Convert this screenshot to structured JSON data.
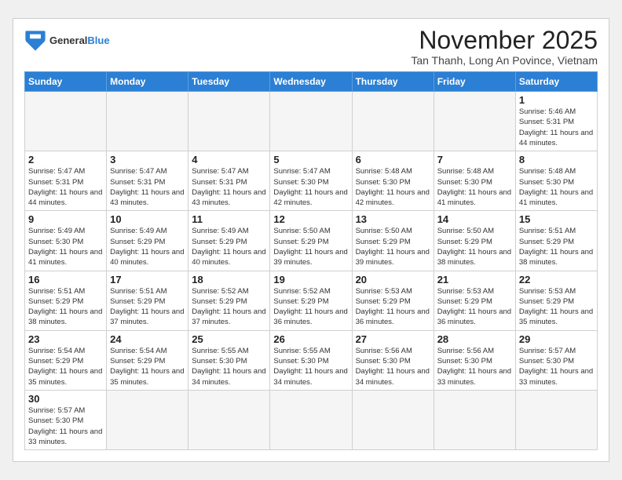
{
  "header": {
    "logo_general": "General",
    "logo_blue": "Blue",
    "month_title": "November 2025",
    "location": "Tan Thanh, Long An Povince, Vietnam"
  },
  "days_of_week": [
    "Sunday",
    "Monday",
    "Tuesday",
    "Wednesday",
    "Thursday",
    "Friday",
    "Saturday"
  ],
  "weeks": [
    [
      {
        "day": "",
        "empty": true
      },
      {
        "day": "",
        "empty": true
      },
      {
        "day": "",
        "empty": true
      },
      {
        "day": "",
        "empty": true
      },
      {
        "day": "",
        "empty": true
      },
      {
        "day": "",
        "empty": true
      },
      {
        "day": "1",
        "sunrise": "5:46 AM",
        "sunset": "5:31 PM",
        "daylight": "11 hours and 44 minutes."
      }
    ],
    [
      {
        "day": "2",
        "sunrise": "5:47 AM",
        "sunset": "5:31 PM",
        "daylight": "11 hours and 44 minutes."
      },
      {
        "day": "3",
        "sunrise": "5:47 AM",
        "sunset": "5:31 PM",
        "daylight": "11 hours and 43 minutes."
      },
      {
        "day": "4",
        "sunrise": "5:47 AM",
        "sunset": "5:31 PM",
        "daylight": "11 hours and 43 minutes."
      },
      {
        "day": "5",
        "sunrise": "5:47 AM",
        "sunset": "5:30 PM",
        "daylight": "11 hours and 42 minutes."
      },
      {
        "day": "6",
        "sunrise": "5:48 AM",
        "sunset": "5:30 PM",
        "daylight": "11 hours and 42 minutes."
      },
      {
        "day": "7",
        "sunrise": "5:48 AM",
        "sunset": "5:30 PM",
        "daylight": "11 hours and 41 minutes."
      },
      {
        "day": "8",
        "sunrise": "5:48 AM",
        "sunset": "5:30 PM",
        "daylight": "11 hours and 41 minutes."
      }
    ],
    [
      {
        "day": "9",
        "sunrise": "5:49 AM",
        "sunset": "5:30 PM",
        "daylight": "11 hours and 41 minutes."
      },
      {
        "day": "10",
        "sunrise": "5:49 AM",
        "sunset": "5:29 PM",
        "daylight": "11 hours and 40 minutes."
      },
      {
        "day": "11",
        "sunrise": "5:49 AM",
        "sunset": "5:29 PM",
        "daylight": "11 hours and 40 minutes."
      },
      {
        "day": "12",
        "sunrise": "5:50 AM",
        "sunset": "5:29 PM",
        "daylight": "11 hours and 39 minutes."
      },
      {
        "day": "13",
        "sunrise": "5:50 AM",
        "sunset": "5:29 PM",
        "daylight": "11 hours and 39 minutes."
      },
      {
        "day": "14",
        "sunrise": "5:50 AM",
        "sunset": "5:29 PM",
        "daylight": "11 hours and 38 minutes."
      },
      {
        "day": "15",
        "sunrise": "5:51 AM",
        "sunset": "5:29 PM",
        "daylight": "11 hours and 38 minutes."
      }
    ],
    [
      {
        "day": "16",
        "sunrise": "5:51 AM",
        "sunset": "5:29 PM",
        "daylight": "11 hours and 38 minutes."
      },
      {
        "day": "17",
        "sunrise": "5:51 AM",
        "sunset": "5:29 PM",
        "daylight": "11 hours and 37 minutes."
      },
      {
        "day": "18",
        "sunrise": "5:52 AM",
        "sunset": "5:29 PM",
        "daylight": "11 hours and 37 minutes."
      },
      {
        "day": "19",
        "sunrise": "5:52 AM",
        "sunset": "5:29 PM",
        "daylight": "11 hours and 36 minutes."
      },
      {
        "day": "20",
        "sunrise": "5:53 AM",
        "sunset": "5:29 PM",
        "daylight": "11 hours and 36 minutes."
      },
      {
        "day": "21",
        "sunrise": "5:53 AM",
        "sunset": "5:29 PM",
        "daylight": "11 hours and 36 minutes."
      },
      {
        "day": "22",
        "sunrise": "5:53 AM",
        "sunset": "5:29 PM",
        "daylight": "11 hours and 35 minutes."
      }
    ],
    [
      {
        "day": "23",
        "sunrise": "5:54 AM",
        "sunset": "5:29 PM",
        "daylight": "11 hours and 35 minutes."
      },
      {
        "day": "24",
        "sunrise": "5:54 AM",
        "sunset": "5:29 PM",
        "daylight": "11 hours and 35 minutes."
      },
      {
        "day": "25",
        "sunrise": "5:55 AM",
        "sunset": "5:30 PM",
        "daylight": "11 hours and 34 minutes."
      },
      {
        "day": "26",
        "sunrise": "5:55 AM",
        "sunset": "5:30 PM",
        "daylight": "11 hours and 34 minutes."
      },
      {
        "day": "27",
        "sunrise": "5:56 AM",
        "sunset": "5:30 PM",
        "daylight": "11 hours and 34 minutes."
      },
      {
        "day": "28",
        "sunrise": "5:56 AM",
        "sunset": "5:30 PM",
        "daylight": "11 hours and 33 minutes."
      },
      {
        "day": "29",
        "sunrise": "5:57 AM",
        "sunset": "5:30 PM",
        "daylight": "11 hours and 33 minutes."
      }
    ],
    [
      {
        "day": "30",
        "sunrise": "5:57 AM",
        "sunset": "5:30 PM",
        "daylight": "11 hours and 33 minutes."
      },
      {
        "day": "",
        "empty": true
      },
      {
        "day": "",
        "empty": true
      },
      {
        "day": "",
        "empty": true
      },
      {
        "day": "",
        "empty": true
      },
      {
        "day": "",
        "empty": true
      },
      {
        "day": "",
        "empty": true
      }
    ]
  ],
  "labels": {
    "sunrise_prefix": "Sunrise: ",
    "sunset_prefix": "Sunset: ",
    "daylight_prefix": "Daylight: "
  }
}
